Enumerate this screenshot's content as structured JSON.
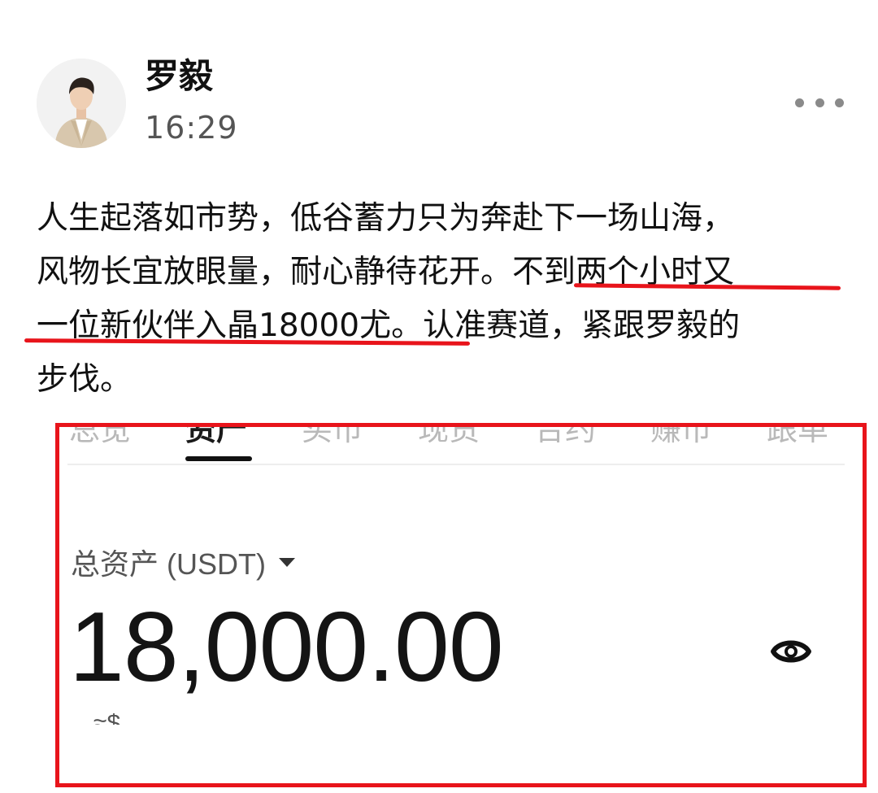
{
  "post": {
    "author_name": "罗毅",
    "time": "16:29",
    "more_icon": "more-horizontal-icon",
    "text_lines": [
      "人生起落如市势，低谷蓄力只为奔赴下一场山海，",
      "风物长宜放眼量，耐心静待花开。不到两个小时又",
      "一位新伙伴入晶18000尤。认准赛道，紧跟罗毅的",
      "步伐。"
    ],
    "underline_color": "#e8141b"
  },
  "embedded_screenshot": {
    "frame_color": "#e8141b",
    "tabs": [
      {
        "label": "总览",
        "active": false
      },
      {
        "label": "资产",
        "active": true
      },
      {
        "label": "买币",
        "active": false
      },
      {
        "label": "现货",
        "active": false
      },
      {
        "label": "合约",
        "active": false
      },
      {
        "label": "赚币",
        "active": false
      },
      {
        "label": "跟单",
        "active": false
      }
    ],
    "asset_label": "总资产 (USDT)",
    "dropdown_icon": "caret-down-icon",
    "amount": "18,000.00",
    "visibility_icon": "eye-icon",
    "partial_text": "≈$"
  }
}
